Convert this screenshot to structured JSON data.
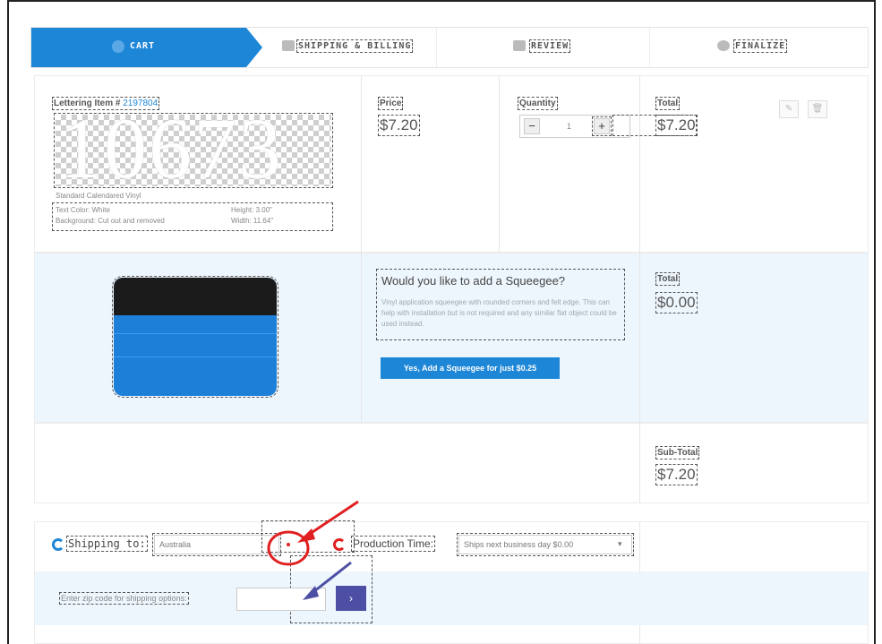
{
  "steps": {
    "cart": "CART",
    "shipping": "SHIPPING & BILLING",
    "review": "REVIEW",
    "finalize": "FINALIZE"
  },
  "item": {
    "label": "Lettering Item #",
    "number": "2197804",
    "preview_text": "10673",
    "material": "Standard Calendared Vinyl",
    "text_color": "Text Color: White",
    "background": "Background: Cut out and removed",
    "height": "Height: 3.00\"",
    "width": "Width: 11.64\""
  },
  "price": {
    "label": "Price",
    "value": "$7.20"
  },
  "quantity": {
    "label": "Quantity",
    "minus": "−",
    "value": "1",
    "plus": "+"
  },
  "total": {
    "label": "Total",
    "value": "$7.20"
  },
  "actions": {
    "edit": "✎",
    "delete": "🗑"
  },
  "addon": {
    "title": "Would you like to add a Squeegee?",
    "description": "Vinyl application squeegee with rounded corners and felt edge. This can help with installation but is not required and any similar flat object could be used instead.",
    "button": "Yes, Add a Squeegee for just $0.25",
    "total_label": "Total",
    "total_value": "$0.00"
  },
  "subtotal": {
    "label": "Sub-Total",
    "value": "$7.20"
  },
  "shipping": {
    "label": "Shipping to:",
    "country": "Australia",
    "production_label": "Production Time:",
    "production_value": "Ships next business day $0.00",
    "zip_label": "Enter zip code for shipping options:",
    "zip_value": "",
    "zip_button": "›"
  },
  "colors": {
    "accent": "#1d86d6",
    "annotation_red": "#e02020",
    "annotation_purple": "#4c4fa3"
  }
}
